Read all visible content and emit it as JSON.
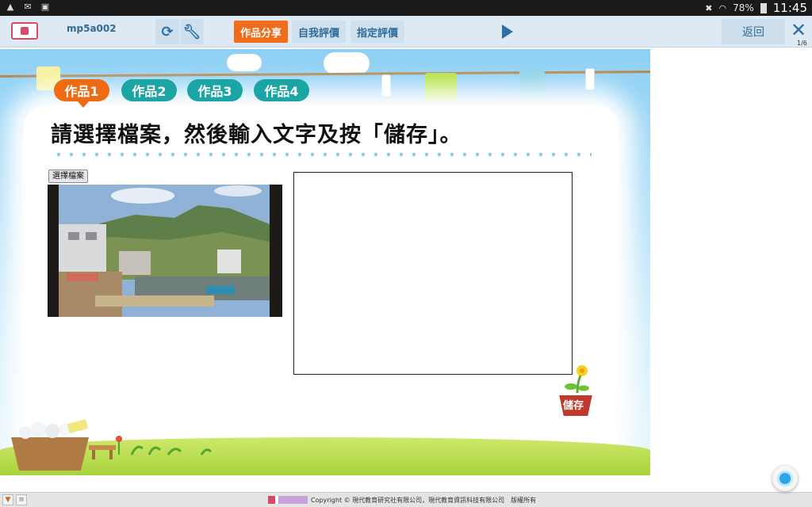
{
  "statusbar": {
    "battery": "78%",
    "time": "11:45",
    "icons": [
      "warning-icon",
      "mail-icon",
      "image-icon",
      "mute-icon",
      "wifi-icon",
      "battery-icon"
    ]
  },
  "toolbar": {
    "code": "mp5a002",
    "tabs": [
      "作品分享",
      "自我評價",
      "指定評價"
    ],
    "active_tab": "作品分享",
    "back_label": "返回",
    "close_label": "✕",
    "pager": "1/6"
  },
  "content": {
    "work_tabs": [
      "作品1",
      "作品2",
      "作品3",
      "作品4"
    ],
    "instruction": "請選擇檔案，然後輸入文字及按「儲存」。",
    "file_button": "選擇檔案",
    "save_label": "儲存"
  },
  "footer": {
    "copyright": "Copyright © 現代教育研究社有限公司，現代教育資訊科技有限公司　版權所有"
  },
  "colors": {
    "accent_orange": "#ee6a13",
    "teal": "#1ba6a5",
    "toolbar_blue": "#2f6b9b"
  }
}
